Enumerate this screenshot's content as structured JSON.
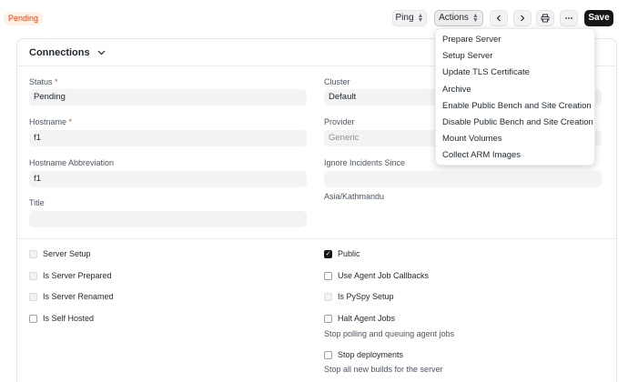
{
  "status_badge": "Pending",
  "toolbar": {
    "ping_label": "Ping",
    "actions_label": "Actions",
    "prev_icon": "chevron-left-icon",
    "next_icon": "chevron-right-icon",
    "print_icon": "printer-icon",
    "more_icon": "ellipsis-icon",
    "save_label": "Save"
  },
  "section": {
    "title": "Connections"
  },
  "fields": {
    "status": {
      "label": "Status",
      "required": "*",
      "value": "Pending"
    },
    "hostname": {
      "label": "Hostname",
      "required": "*",
      "value": "f1"
    },
    "hostname_abbreviation": {
      "label": "Hostname Abbreviation",
      "value": "f1"
    },
    "title": {
      "label": "Title",
      "value": ""
    },
    "cluster": {
      "label": "Cluster",
      "value": "Default"
    },
    "provider": {
      "label": "Provider",
      "value": "Generic"
    },
    "ignore_incidents_since": {
      "label": "Ignore Incidents Since",
      "value": "",
      "note": "Asia/Kathmandu"
    }
  },
  "checkboxes_left": [
    {
      "label": "Server Setup",
      "checked": false,
      "disabled": true
    },
    {
      "label": "Is Server Prepared",
      "checked": false,
      "disabled": true
    },
    {
      "label": "Is Server Renamed",
      "checked": false,
      "disabled": true
    },
    {
      "label": "Is Self Hosted",
      "checked": false,
      "disabled": false
    }
  ],
  "checkboxes_right": [
    {
      "label": "Public",
      "checked": true,
      "disabled": false
    },
    {
      "label": "Use Agent Job Callbacks",
      "checked": false,
      "disabled": false
    },
    {
      "label": "Is PySpy Setup",
      "checked": false,
      "disabled": true
    },
    {
      "label": "Halt Agent Jobs",
      "checked": false,
      "disabled": false,
      "note": "Stop polling and queuing agent jobs"
    },
    {
      "label": "Stop deployments",
      "checked": false,
      "disabled": false,
      "note": "Stop all new builds for the server"
    }
  ],
  "actions_menu": [
    "Prepare Server",
    "Setup Server",
    "Update TLS Certificate",
    "Archive",
    "Enable Public Bench and Site Creation",
    "Disable Public Bench and Site Creation",
    "Mount Volumes",
    "Collect ARM Images"
  ],
  "colors": {
    "accent": "#171717",
    "badge_bg": "#fff1e7",
    "badge_text": "#d9480f"
  }
}
